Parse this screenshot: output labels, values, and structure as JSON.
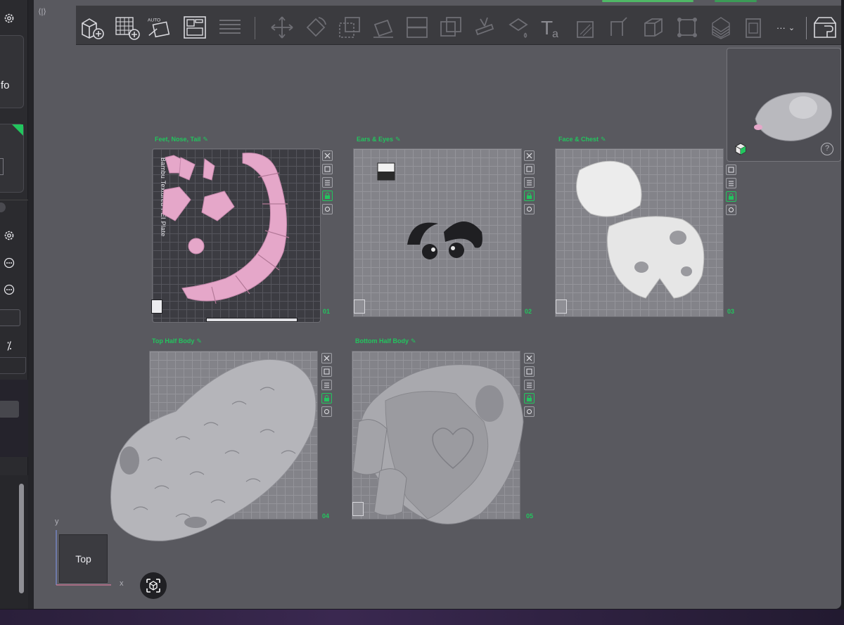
{
  "sidebar": {
    "partial_label": "fo",
    "buttons": [
      "settings",
      "more",
      "more",
      "swap"
    ]
  },
  "toolbar": {
    "auto_label": "AUTO",
    "more_label": "···"
  },
  "plates": [
    {
      "label": "Feet, Nose, Tail",
      "number": "01",
      "texture_name": "Bambu Textured PEI Plate",
      "edit_icon": "pencil-icon"
    },
    {
      "label": "Ears & Eyes",
      "number": "02",
      "edit_icon": "pencil-icon"
    },
    {
      "label": "Face & Chest",
      "number": "03",
      "edit_icon": "pencil-icon"
    },
    {
      "label": "Top Half Body",
      "number": "04",
      "edit_icon": "pencil-icon"
    },
    {
      "label": "Bottom Half Body",
      "number": "05",
      "edit_icon": "pencil-icon"
    }
  ],
  "view_cube": {
    "face": "Top",
    "x_axis": "x",
    "y_axis": "y"
  },
  "preview": {
    "help": "?"
  },
  "colors": {
    "accent": "#22c55e",
    "viewport": "#59595f",
    "plate": "#838389",
    "pink": "#e5a7c9"
  }
}
